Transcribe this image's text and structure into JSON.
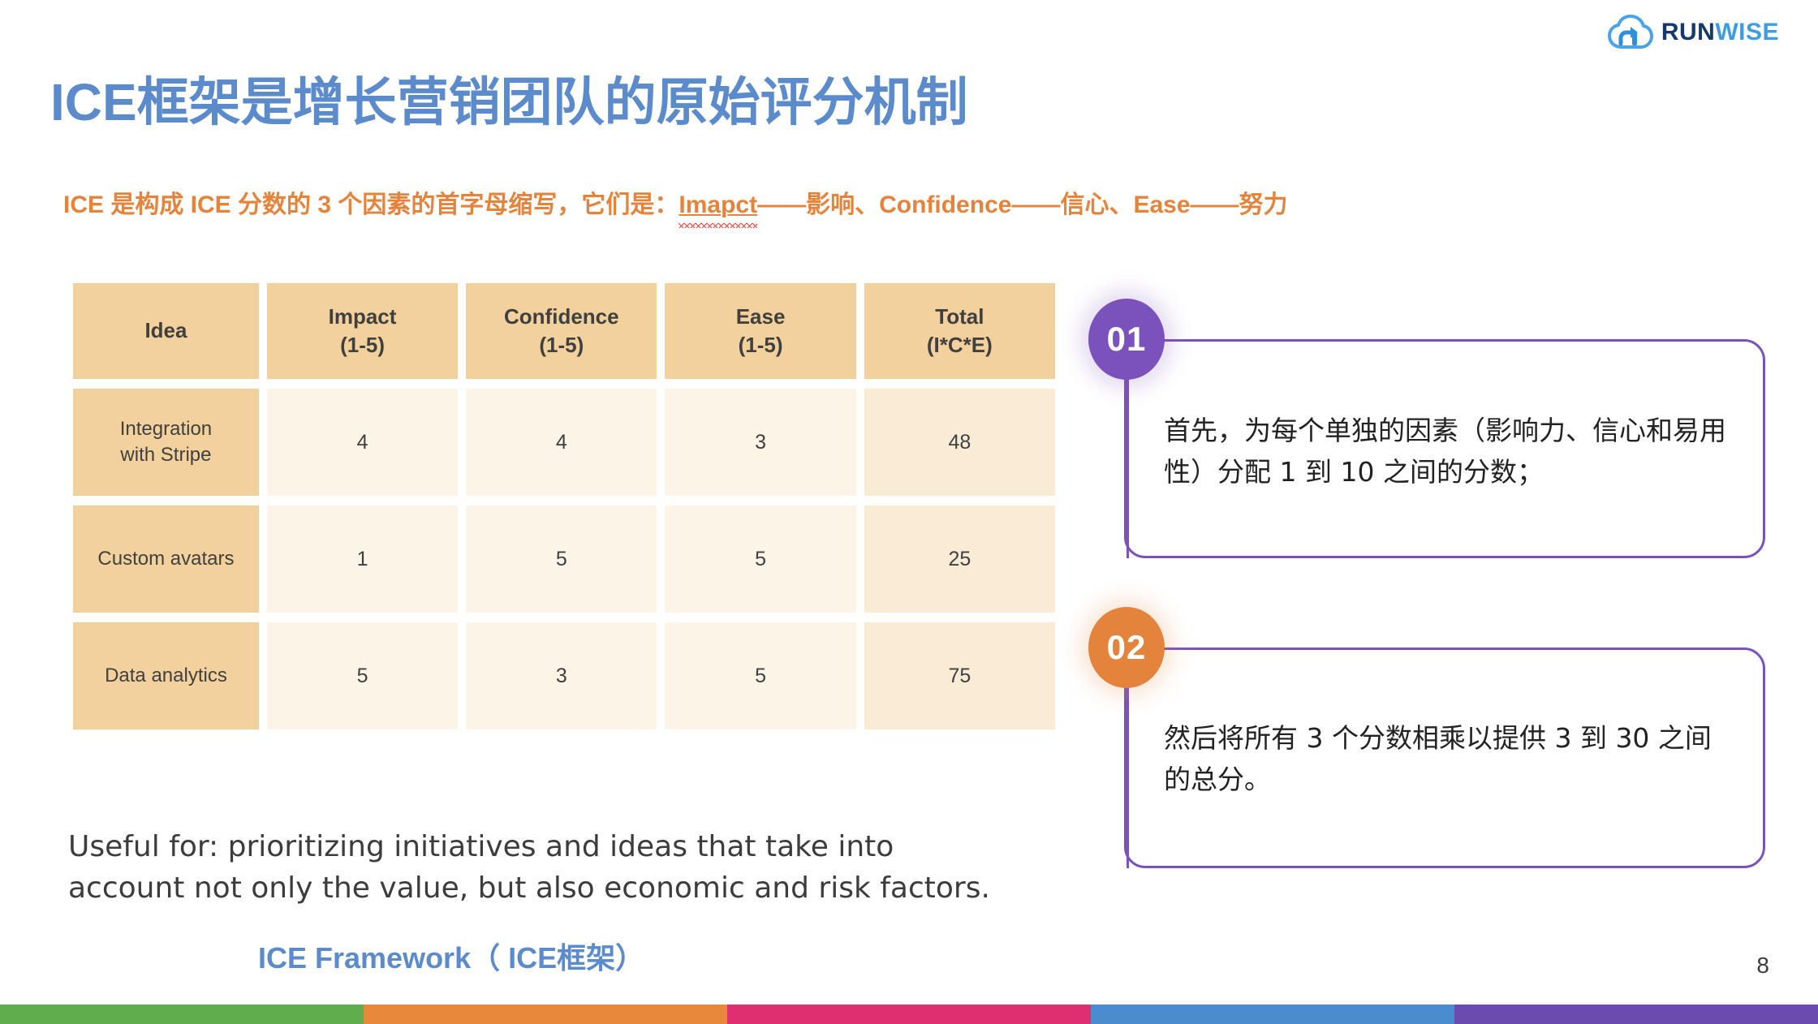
{
  "brand": {
    "logo_icon": "cloud-arrow-icon",
    "name_part1": "RUN",
    "name_part2": "WISE",
    "color_dark": "#15396b",
    "color_light": "#3e9de0"
  },
  "slide": {
    "title": "ICE框架是增长营销团队的原始评分机制",
    "title_color": "#5b8bcb",
    "subtitle_prefix": "ICE 是构成 ICE 分数的 3 个因素的首字母缩写，它们是：",
    "subtitle_misspelled_word": "Imapct",
    "subtitle_suffix": "——影响、Confidence——信心、Ease——努力",
    "subtitle_color": "#e4833c",
    "page_number": "8"
  },
  "table": {
    "headers": [
      {
        "line1": "Idea",
        "line2": ""
      },
      {
        "line1": "Impact",
        "line2": "(1-5)"
      },
      {
        "line1": "Confidence",
        "line2": "(1-5)"
      },
      {
        "line1": "Ease",
        "line2": "(1-5)"
      },
      {
        "line1": "Total",
        "line2": "(I*C*E)"
      }
    ],
    "rows": [
      {
        "idea_line1": "Integration",
        "idea_line2": "with Stripe",
        "impact": "4",
        "confidence": "4",
        "ease": "3",
        "total": "48"
      },
      {
        "idea_line1": "Custom avatars",
        "idea_line2": "",
        "impact": "1",
        "confidence": "5",
        "ease": "5",
        "total": "25"
      },
      {
        "idea_line1": "Data analytics",
        "idea_line2": "",
        "impact": "5",
        "confidence": "3",
        "ease": "5",
        "total": "75"
      }
    ],
    "header_bg": "#f3d19c",
    "idea_bg": "#f3d19c",
    "value_bg": "#fdf4e8",
    "total_bg": "#faecd4"
  },
  "useful_for": {
    "line1": "Useful for: prioritizing initiatives and ideas that take into",
    "line2": "account not only the value, but also economic and risk factors."
  },
  "caption": "ICE Framework（ ICE框架）",
  "callouts": [
    {
      "badge": "01",
      "badge_color": "#7b52bc",
      "text": "首先，为每个单独的因素（影响力、信心和易用性）分配 1 到 10 之间的分数；"
    },
    {
      "badge": "02",
      "badge_color": "#e4833c",
      "text": "然后将所有 3 个分数相乘以提供 3 到 30 之间的总分。"
    }
  ],
  "bottom_bar_colors": [
    "#5fae4e",
    "#e8883a",
    "#e02f70",
    "#4a8ccd",
    "#6b4bb0"
  ]
}
